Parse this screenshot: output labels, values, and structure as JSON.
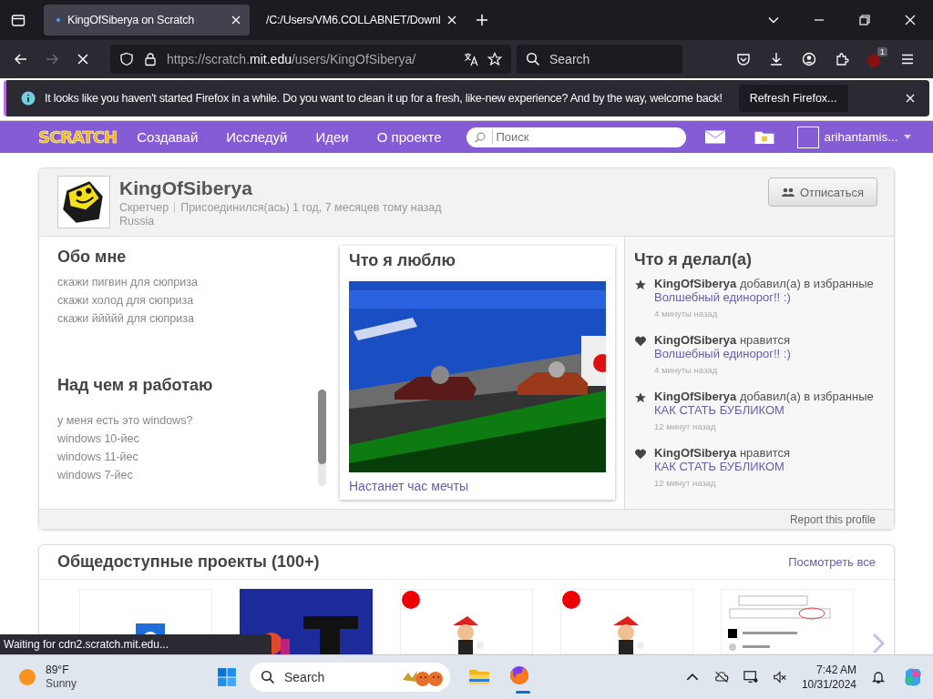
{
  "browser": {
    "tabs": [
      {
        "title": "KingOfSiberya on Scratch",
        "selected": true
      },
      {
        "title": "/C:/Users/VM6.COLLABNET/Downl",
        "selected": false
      }
    ],
    "url": {
      "prefix": "https://scratch.",
      "host": "mit.edu",
      "path": "/users/KingOfSiberya/"
    },
    "search": {
      "placeholder": "Search"
    },
    "extension_badge": "1",
    "notification": {
      "message": "It looks like you haven't started Firefox in a while. Do you want to clean it up for a fresh, like-new experience? And by the way, welcome back!",
      "button": "Refresh Firefox..."
    },
    "status": "Waiting for cdn2.scratch.mit.edu..."
  },
  "scratch_nav": {
    "logo": "SCRATCH",
    "items": [
      "Создавай",
      "Исследуй",
      "Идеи",
      "О проекте"
    ],
    "search": {
      "placeholder": "Поиск"
    },
    "username": "arihantamis..."
  },
  "profile": {
    "username": "KingOfSiberya",
    "role": "Скретчер",
    "joined": "Присоединился(ась) 1 год, 7 месяцев тому назад",
    "location": "Russia",
    "button": "Отписаться"
  },
  "about": {
    "title": "Обо мне",
    "lines": [
      "скажи пигвин для сюприза",
      "скажи холод для сюприза",
      "скажи ййййй для сюприза"
    ]
  },
  "working_on": {
    "title": "Над чем я работаю",
    "lines": [
      "у меня есть это windows?",
      "windows 10-йес",
      "windows 11-йес",
      "windows 7-йес"
    ]
  },
  "favorite": {
    "title": "Что я люблю",
    "project": "Настанет час мечты"
  },
  "activity": {
    "title": "Что я делал(а)",
    "items": [
      {
        "kind": "favorite",
        "user": "KingOfSiberya",
        "action": "добавил(а) в избранные",
        "project": "Волшебный единорог!! :)",
        "time": "4 минуты назад"
      },
      {
        "kind": "love",
        "user": "KingOfSiberya",
        "action": "нравится",
        "project": "Волшебный единорог!! :)",
        "time": "4 минуты назад"
      },
      {
        "kind": "favorite",
        "user": "KingOfSiberya",
        "action": "добавил(а) в избранные",
        "project": "КАК СТАТЬ БУБЛИКОМ",
        "time": "12 минут назад"
      },
      {
        "kind": "love",
        "user": "KingOfSiberya",
        "action": "нравится",
        "project": "КАК СТАТЬ БУБЛИКОМ",
        "time": "12 минут назад"
      }
    ]
  },
  "report": "Report this profile",
  "projects": {
    "title": "Общедоступные проекты (100+)",
    "see_all": "Посмотреть все"
  },
  "taskbar": {
    "weather": {
      "temp": "89°F",
      "condition": "Sunny"
    },
    "search": {
      "placeholder": "Search"
    },
    "time": "7:42 AM",
    "date": "10/31/2024"
  }
}
